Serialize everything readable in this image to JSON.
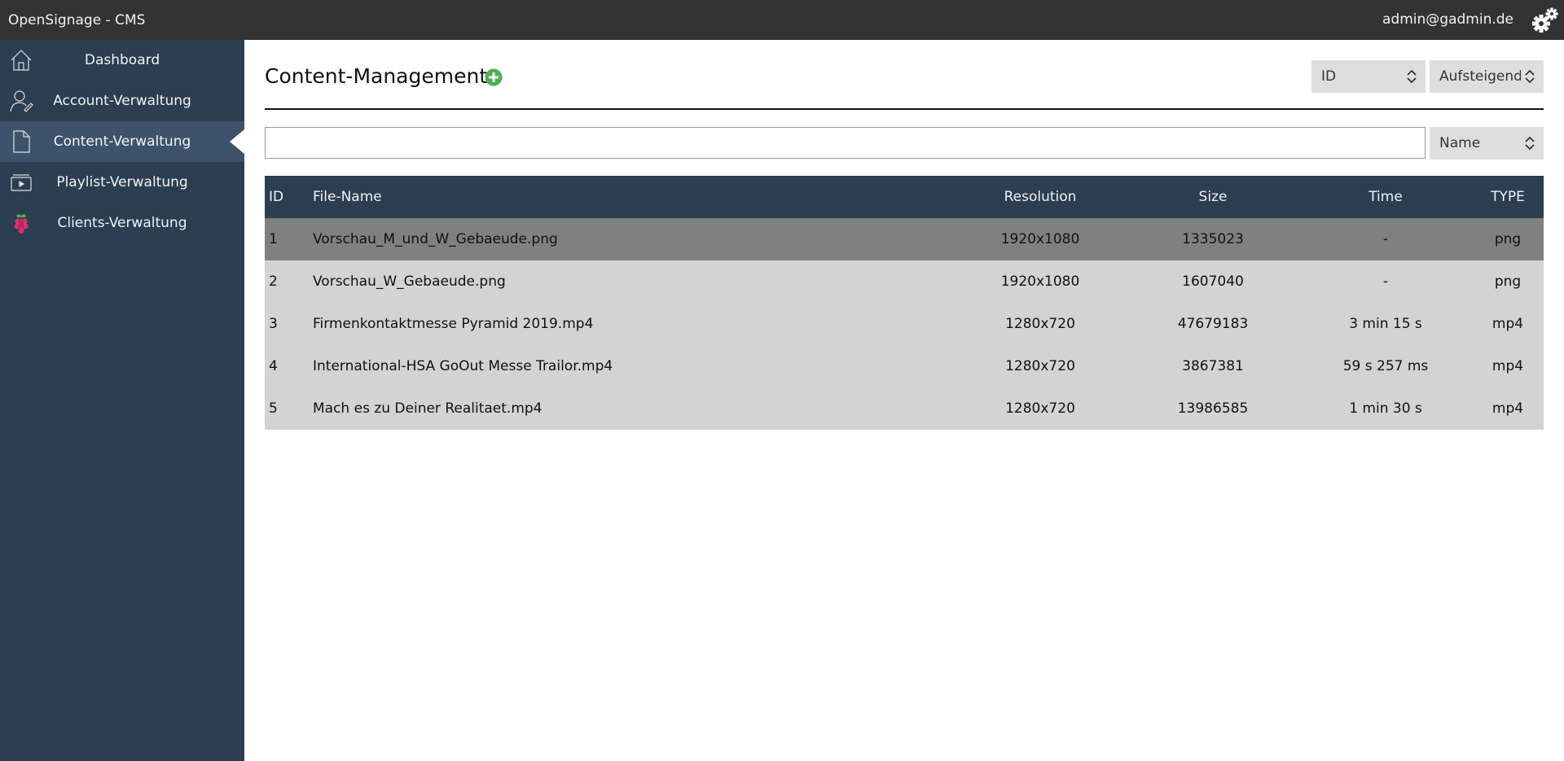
{
  "topbar": {
    "title": "OpenSignage - CMS",
    "user": "admin@gadmin.de",
    "settings_icon": "gear-icon"
  },
  "sidebar": {
    "items": [
      {
        "label": "Dashboard",
        "icon": "home-icon",
        "active": false
      },
      {
        "label": "Account-Verwaltung",
        "icon": "user-icon",
        "active": false
      },
      {
        "label": "Content-Verwaltung",
        "icon": "document-icon",
        "active": true
      },
      {
        "label": "Playlist-Verwaltung",
        "icon": "video-icon",
        "active": false
      },
      {
        "label": "Clients-Verwaltung",
        "icon": "raspberry-icon",
        "active": false
      }
    ]
  },
  "main": {
    "title": "Content-Management",
    "add_icon": "plus-circle-icon",
    "sort_field": "ID",
    "sort_order": "Aufsteigend",
    "search_value": "",
    "filter_field": "Name"
  },
  "table": {
    "headers": [
      "ID",
      "File-Name",
      "Resolution",
      "Size",
      "Time",
      "TYPE"
    ],
    "rows": [
      {
        "id": "1",
        "name": "Vorschau_M_und_W_Gebaeude.png",
        "resolution": "1920x1080",
        "size": "1335023",
        "time": "-",
        "type": "png",
        "selected": true
      },
      {
        "id": "2",
        "name": "Vorschau_W_Gebaeude.png",
        "resolution": "1920x1080",
        "size": "1607040",
        "time": "-",
        "type": "png",
        "selected": false
      },
      {
        "id": "3",
        "name": "Firmenkontaktmesse Pyramid 2019.mp4",
        "resolution": "1280x720",
        "size": "47679183",
        "time": "3 min 15 s",
        "type": "mp4",
        "selected": false
      },
      {
        "id": "4",
        "name": "International-HSA GoOut Messe Trailor.mp4",
        "resolution": "1280x720",
        "size": "3867381",
        "time": "59 s 257 ms",
        "type": "mp4",
        "selected": false
      },
      {
        "id": "5",
        "name": "Mach es zu Deiner Realitaet.mp4",
        "resolution": "1280x720",
        "size": "13986585",
        "time": "1 min 30 s",
        "type": "mp4",
        "selected": false
      }
    ]
  },
  "colors": {
    "topbar": "#333333",
    "sidebar": "#2b3e52",
    "sidebar_active": "#3c536b",
    "row": "#d3d3d3",
    "row_selected": "#808080",
    "add_button": "#4caf50"
  }
}
